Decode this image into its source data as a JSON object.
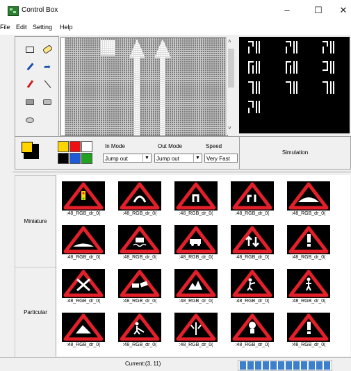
{
  "window": {
    "title": "Control Box",
    "min_icon": "minimize-icon",
    "max_icon": "maximize-icon",
    "close_icon": "close-icon"
  },
  "menu": [
    "File",
    "Edit",
    "Setting",
    "Help"
  ],
  "tools": [
    "rectangle-icon",
    "eraser-icon",
    "eyedropper-icon",
    "fill-icon",
    "pencil-icon",
    "line-icon",
    "filled-rect-icon",
    "rounded-rect-icon",
    "ellipse-icon"
  ],
  "palette": {
    "colors": [
      "#ffd400",
      "#e11",
      "#ffffff",
      "#000000",
      "#1e5bd6",
      "#22a022"
    ]
  },
  "modes": {
    "in_label": "In Mode",
    "out_label": "Out Mode",
    "speed_label": "Speed",
    "in_value": "Jump out",
    "out_value": "Jump out",
    "speed_value": "Very Fast"
  },
  "simulation_label": "Simulation",
  "side_tabs": [
    "Miniature",
    "Particular"
  ],
  "gallery": {
    "item_label": ":48_RGB_dr_0("
  },
  "status": {
    "text": "Current:(3, 11)",
    "progress": 1.0
  }
}
